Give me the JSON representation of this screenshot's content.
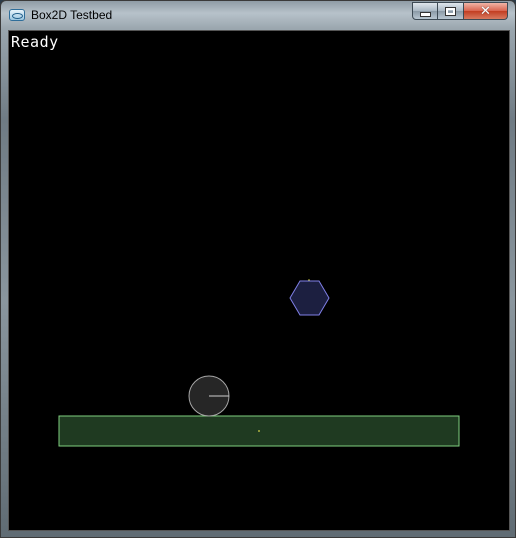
{
  "window": {
    "title": "Box2D Testbed",
    "buttons": {
      "minimize": "minimize",
      "maximize": "maximize",
      "close": "✕"
    }
  },
  "testbed": {
    "status": "Ready"
  },
  "colors": {
    "background": "#000000",
    "ground_fill": "#1f3a21",
    "ground_stroke": "#7fd07f",
    "hexagon_fill": "#1c1f40",
    "hexagon_stroke": "#7f7fe6",
    "circle_fill": "#262626",
    "circle_stroke": "#a6a6a6"
  }
}
